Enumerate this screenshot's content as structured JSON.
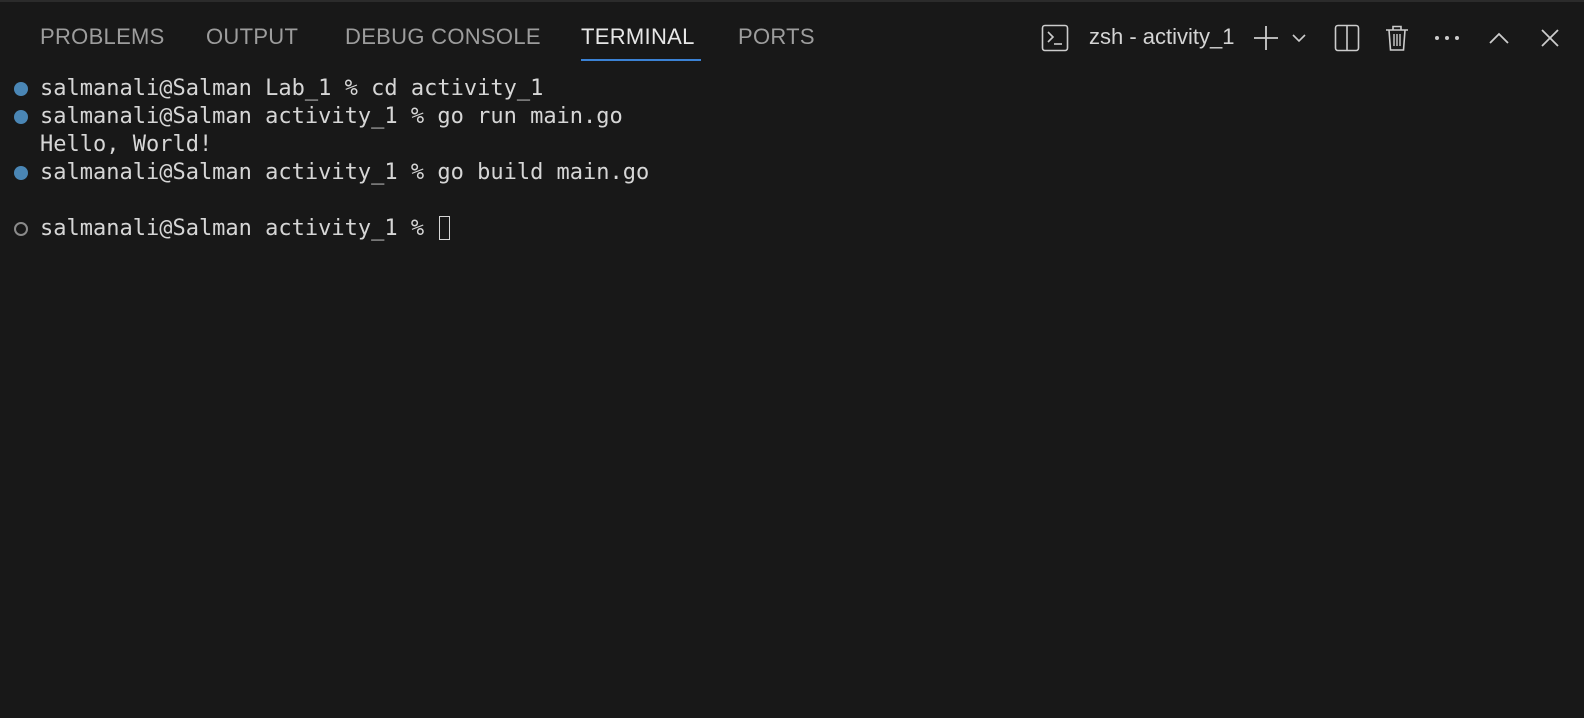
{
  "tabs": [
    {
      "label": "PROBLEMS"
    },
    {
      "label": "OUTPUT"
    },
    {
      "label": "DEBUG CONSOLE"
    },
    {
      "label": "TERMINAL",
      "active": true
    },
    {
      "label": "PORTS"
    }
  ],
  "toolbar": {
    "terminal_name": "zsh - activity_1",
    "icons": [
      "terminal-icon",
      "plus-icon",
      "chevron-down-icon",
      "split-icon",
      "trash-icon",
      "ellipsis-icon",
      "chevron-up-icon",
      "close-icon"
    ]
  },
  "terminal": {
    "lines": [
      {
        "text": "salmanali@Salman Lab_1 % cd activity_1",
        "decoration": "success"
      },
      {
        "text": "salmanali@Salman activity_1 % go run main.go",
        "decoration": "success"
      },
      {
        "text": "Hello, World!",
        "decoration": "none"
      },
      {
        "text": "salmanali@Salman activity_1 % go build main.go",
        "decoration": "success"
      },
      {
        "text": "",
        "decoration": "none"
      },
      {
        "text": "salmanali@Salman activity_1 % ",
        "decoration": "pending"
      }
    ]
  },
  "colors": {
    "background": "#181818",
    "active_tab_underline": "#3b82d4",
    "decoration_success": "#4a86b5",
    "text": "#d6d6d6"
  }
}
